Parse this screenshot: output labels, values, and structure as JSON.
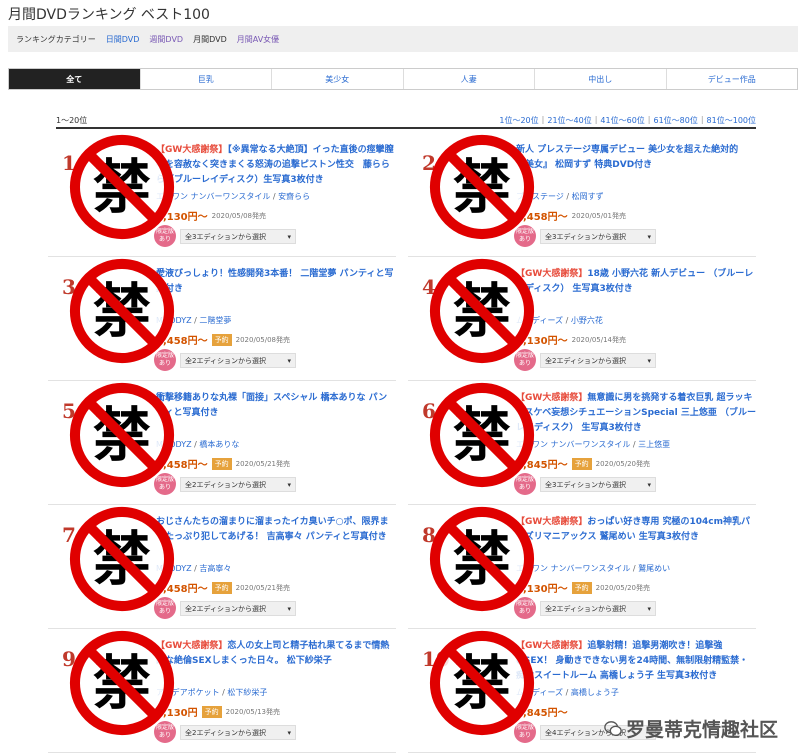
{
  "page_title": "月間DVDランキング ベスト100",
  "categories": {
    "label": "ランキングカテゴリー",
    "items": [
      "日間DVD",
      "週間DVD",
      "月間DVD",
      "月間AV女優"
    ]
  },
  "tabs": [
    "全て",
    "巨乳",
    "美少女",
    "人妻",
    "中出し",
    "デビュー作品"
  ],
  "range": {
    "current": "1〜20位",
    "links": [
      "1位〜20位",
      "21位〜40位",
      "41位〜60位",
      "61位〜80位",
      "81位〜100位"
    ]
  },
  "items": [
    {
      "rank": "1",
      "highlight": "【GW大感謝祭】",
      "title": "【※異常なる大絶頂】イった直後の痙攣膣中を容赦なく突きまくる怒涛の追撃ピストン性交　藤ららら（ブルーレイディスク）生写真3枚付き",
      "maker": "エスワン ナンバーワンスタイル",
      "actress": "安齋らら",
      "price": "2,130円〜",
      "preorder": "",
      "release": "2020/05/08発売",
      "limited": "限定版あり",
      "edition": "全3エディションから選択"
    },
    {
      "rank": "2",
      "highlight": "",
      "title": "新人 プレステージ専属デビュー 美少女を超えた絶対的『美女』 松岡すず 特典DVD付き",
      "maker": "プレステージ",
      "actress": "松岡すず",
      "price": "2,458円〜",
      "preorder": "",
      "release": "2020/05/01発売",
      "limited": "限定版あり",
      "edition": "全3エディションから選択"
    },
    {
      "rank": "3",
      "highlight": "",
      "title": "愛液びっしょり！性感開発3本番！ 二階堂夢 パンティと写真付き",
      "maker": "MOODYZ",
      "actress": "二階堂夢",
      "price": "2,458円〜",
      "preorder": "予約",
      "release": "2020/05/08発売",
      "limited": "限定版あり",
      "edition": "全2エディションから選択"
    },
    {
      "rank": "4",
      "highlight": "【GW大感謝祭】",
      "title": "18歳 小野六花 新人デビュー （ブルーレイディスク） 生写真3枚付き",
      "maker": "ムーディーズ",
      "actress": "小野六花",
      "price": "2,130円〜",
      "preorder": "",
      "release": "2020/05/14発売",
      "limited": "限定版あり",
      "edition": "全2エディションから選択"
    },
    {
      "rank": "5",
      "highlight": "",
      "title": "衝撃移籍ありな丸裸「面接」スペシャル 橋本ありな パンティと写真付き",
      "maker": "MOODYZ",
      "actress": "橋本ありな",
      "price": "2,458円〜",
      "preorder": "予約",
      "release": "2020/05/21発売",
      "limited": "限定版あり",
      "edition": "全2エディションから選択"
    },
    {
      "rank": "6",
      "highlight": "【GW大感謝祭】",
      "title": "無意識に男を挑発する着衣巨乳 超ラッキースケベ妄想シチュエーションSpecial 三上悠亜 （ブルーレイディスク） 生写真3枚付き",
      "maker": "エスワン ナンバーワンスタイル",
      "actress": "三上悠亜",
      "price": "2,845円〜",
      "preorder": "予約",
      "release": "2020/05/20発売",
      "limited": "限定版あり",
      "edition": "全3エディションから選択"
    },
    {
      "rank": "7",
      "highlight": "",
      "title": "おじさんたちの溜まりに溜まったイカ臭いチ○ポ、限界までたっぷり犯してあげる！ 吉高寧々 パンティと写真付き",
      "maker": "MOODYZ",
      "actress": "吉高寧々",
      "price": "2,458円〜",
      "preorder": "予約",
      "release": "2020/05/21発売",
      "limited": "限定版あり",
      "edition": "全2エディションから選択"
    },
    {
      "rank": "8",
      "highlight": "【GW大感謝祭】",
      "title": "おっぱい好き専用 究極の104cm神乳パイズリマニアックス 鷲尾めい 生写真3枚付き",
      "maker": "エスワン ナンバーワンスタイル",
      "actress": "鷲尾めい",
      "price": "2,130円〜",
      "preorder": "予約",
      "release": "2020/05/20発売",
      "limited": "限定版あり",
      "edition": "全2エディションから選択"
    },
    {
      "rank": "9",
      "highlight": "【GW大感謝祭】",
      "title": "恋人の女上司と精子枯れ果てるまで情熱的な絶倫SEXしまくった日々。 松下紗栄子",
      "maker": "アイデアポケット",
      "actress": "松下紗栄子",
      "price": "2,130円",
      "preorder": "予約",
      "release": "2020/05/13発売",
      "limited": "限定版あり",
      "edition": "全2エディションから選択"
    },
    {
      "rank": "10",
      "highlight": "【GW大感謝祭】",
      "title": "追撃射精！追撃男潮吹き！追撃強●SEX！ 身動きできない男を24時間、無制限射精監禁・痴女スイートルーム 高橋しょう子 生写真3枚付き",
      "maker": "ムーディーズ",
      "actress": "高橋しょう子",
      "price": "2,845円〜",
      "preorder": "",
      "release": "",
      "limited": "限定版あり",
      "edition": "全4エディションから選択"
    }
  ],
  "ban_glyph": "禁",
  "watermark": "罗曼蒂克情趣社区",
  "colors": {
    "link": "#2a6bd1",
    "price": "#d35400",
    "rank": "#c0392b",
    "ban_red": "#e00000"
  }
}
